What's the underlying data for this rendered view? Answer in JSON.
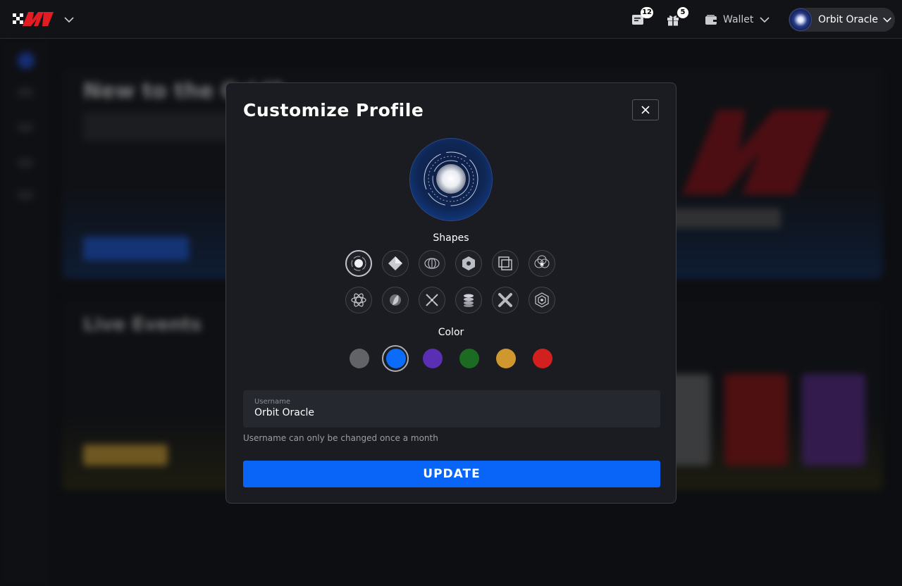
{
  "topbar": {
    "logo": "m1-logo",
    "notifications_count": "12",
    "gifts_count": "5",
    "wallet_label": "Wallet",
    "user_name": "Orbit Oracle"
  },
  "background": {
    "hero_title": "New to the Grid?",
    "events_title": "Live Events"
  },
  "modal": {
    "title": "Customize Profile",
    "shapes_label": "Shapes",
    "shapes": [
      "orbit-icon",
      "diamond-icon",
      "sphere-icon",
      "hexagon-icon",
      "layers-icon",
      "starburst-icon",
      "atom-icon",
      "moon-icon",
      "cross-pattern-icon",
      "stack-icon",
      "x-icon",
      "cube-icon"
    ],
    "selected_shape": "orbit-icon",
    "color_label": "Color",
    "colors": [
      "#626366",
      "#0b6cfa",
      "#5a2fb3",
      "#1c6b22",
      "#cf972e",
      "#d1201e"
    ],
    "selected_color": "#0b6cfa",
    "username_label": "Username",
    "username_value": "Orbit Oracle",
    "hint": "Username can only be changed once a month",
    "update_label": "UPDATE"
  }
}
